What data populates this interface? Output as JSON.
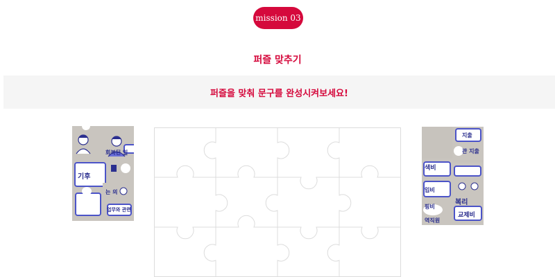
{
  "mission": {
    "label": "mission 03"
  },
  "game": {
    "title": "퍼즐 맞추기",
    "instruction": "퍼즐을 맞춰 문구를 완성시켜보세요!"
  },
  "left_tray": {
    "pieces": [
      {
        "text": "회복된 일"
      },
      {
        "text": "기후"
      },
      {
        "text": "는 의"
      },
      {
        "text": "업무와 관련"
      }
    ]
  },
  "right_tray": {
    "pieces": [
      {
        "text": "지출"
      },
      {
        "text": "관 지출"
      },
      {
        "text": "색비"
      },
      {
        "text": "입비"
      },
      {
        "text": "핑비"
      },
      {
        "text": "복리"
      },
      {
        "text": "교제비"
      },
      {
        "text": "역직원"
      }
    ]
  },
  "board": {
    "rows": 3,
    "cols": 4
  },
  "colors": {
    "accent": "#d5093c",
    "piece_bg": "#c7c3bd",
    "frame_blue": "#4b53c8"
  }
}
